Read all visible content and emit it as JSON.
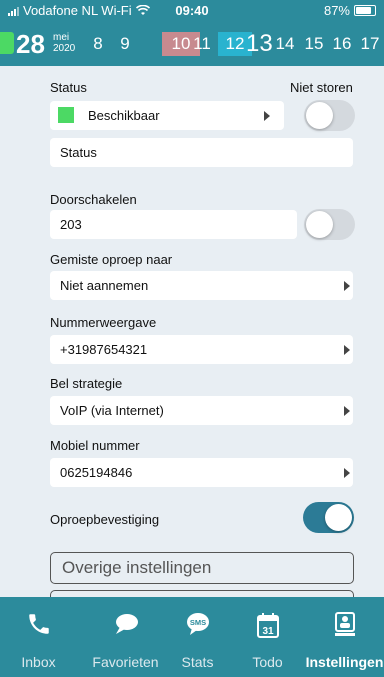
{
  "statusbar": {
    "carrier": "Vodafone NL Wi-Fi",
    "time": "09:40",
    "battery": "87%"
  },
  "datebar": {
    "day": "28",
    "month": "mei",
    "year": "2020",
    "days": [
      "8",
      "9",
      "10",
      "11",
      "12",
      "13",
      "14",
      "15",
      "16",
      "17"
    ]
  },
  "status": {
    "label": "Status",
    "dnd_label": "Niet storen",
    "value": "Beschikbaar",
    "value_color": "#4cd964",
    "dnd_on": false,
    "message": "Status"
  },
  "forward": {
    "label": "Doorschakelen",
    "value": "203",
    "enabled": false
  },
  "missed": {
    "label": "Gemiste oproep naar",
    "value": "Niet aannemen"
  },
  "number_display": {
    "label": "Nummerweergave",
    "value": "+31987654321"
  },
  "call_strategy": {
    "label": "Bel strategie",
    "value": "VoIP (via Internet)"
  },
  "mobile": {
    "label": "Mobiel nummer",
    "value": "0625194846"
  },
  "confirm": {
    "label": "Oproepbevestiging",
    "enabled": true
  },
  "other_settings": "Overige instellingen",
  "colors": {
    "accent": "#2c8b9c",
    "toggle_on": "#2c7b96",
    "day_red": "#c78a8f",
    "day_blue": "#29b3cf"
  },
  "tabs": [
    {
      "label": "Inbox",
      "icon": "phone-icon"
    },
    {
      "label": "Favorieten",
      "icon": "chat-bubble-icon"
    },
    {
      "label": "Stats",
      "icon": "sms-icon"
    },
    {
      "label": "Todo",
      "icon": "calendar-icon"
    },
    {
      "label": "Instellingen",
      "icon": "settings-icon",
      "active": true
    }
  ]
}
